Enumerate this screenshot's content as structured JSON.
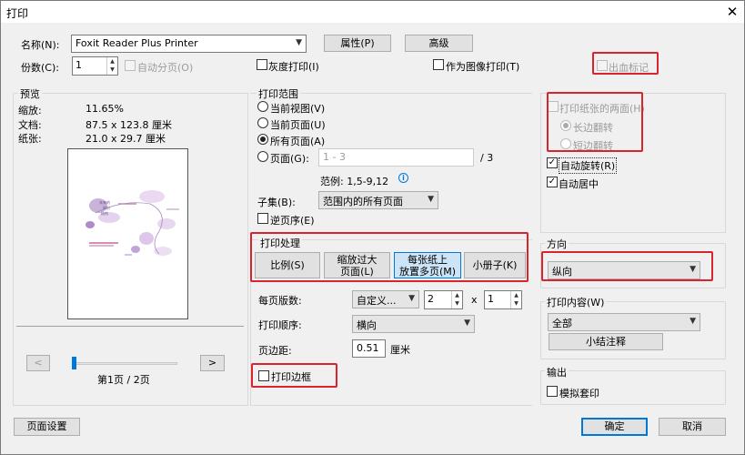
{
  "window": {
    "title": "打印",
    "close_glyph": "✕"
  },
  "printer": {
    "name_label": "名称(N):",
    "name_value": "Foxit Reader Plus Printer",
    "properties_btn": "属性(P)",
    "advanced_btn": "高级",
    "copies_label": "份数(C):",
    "copies_value": "1",
    "collate_label": "自动分页(O)",
    "grayscale_label": "灰度打印(I)",
    "as_image_label": "作为图像打印(T)",
    "bleed_label": "出血标记"
  },
  "preview": {
    "group_label": "预览",
    "zoom_label": "缩放:",
    "zoom_value": "11.65%",
    "doc_label": "文档:",
    "doc_value": "87.5 x 123.8 厘米",
    "paper_label": "纸张:",
    "paper_value": "21.0 x 29.7 厘米",
    "prev_btn": "<",
    "next_btn": ">",
    "page_indicator": "第1页 / 2页",
    "slider_position": 0.0
  },
  "range": {
    "group_label": "打印范围",
    "current_view": "当前视图(V)",
    "current_page": "当前页面(U)",
    "all_pages": "所有页面(A)",
    "pages": "页面(G):",
    "pages_placeholder": "1 - 3",
    "pages_total": "/ 3",
    "example": "范例: 1,5-9,12",
    "info_icon": "i",
    "subset_label": "子集(B):",
    "subset_value": "范围内的所有页面",
    "reverse_label": "逆页序(E)"
  },
  "handling": {
    "group_label": "打印处理",
    "tabs": [
      "比例(S)",
      "缩放过大\n页面(L)",
      "每张纸上\n放置多页(M)",
      "小册子(K)"
    ],
    "selected_tab": 2,
    "per_sheet_label": "每页版数:",
    "per_sheet_value": "自定义...",
    "cols_value": "2",
    "times": "x",
    "rows_value": "1",
    "order_label": "打印顺序:",
    "order_value": "横向",
    "margin_label": "页边距:",
    "margin_value": "0.51",
    "margin_unit": "厘米",
    "border_label": "打印边框"
  },
  "duplex": {
    "both_sides_label": "打印纸张的两面(H)",
    "long_edge": "长边翻转",
    "short_edge": "短边翻转",
    "auto_rotate": "自动旋转(R)",
    "auto_center": "自动居中"
  },
  "orientation": {
    "group_label": "方向",
    "value": "纵向"
  },
  "content": {
    "group_label": "打印内容(W)",
    "value": "全部",
    "summarize_btn": "小结注释"
  },
  "output": {
    "group_label": "输出",
    "simulate_overprint": "模拟套印"
  },
  "footer": {
    "page_setup_btn": "页面设置",
    "ok_btn": "确定",
    "cancel_btn": "取消"
  },
  "thumb": {
    "text_lines": [
      "未来的",
      "知识",
      "结构"
    ]
  }
}
